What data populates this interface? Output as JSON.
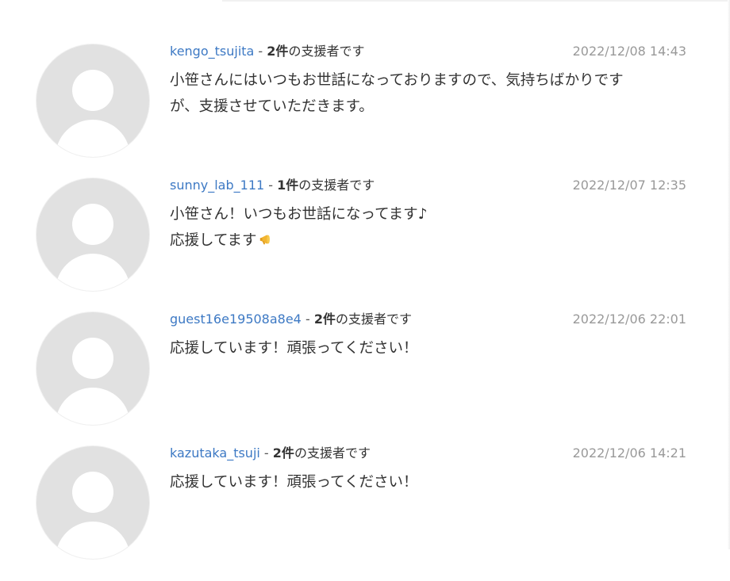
{
  "comments": [
    {
      "username": "kengo_tsujita",
      "separator": " - ",
      "count": "2件",
      "suffix": "の支援者です",
      "date": "2022/12/08 14:43",
      "text": "小笹さんにはいつもお世話になっておりますので、気持ちばかりです\nが、支援させていただきます。"
    },
    {
      "username": "sunny_lab_111",
      "separator": " - ",
      "count": "1件",
      "suffix": "の支援者です",
      "date": "2022/12/07 12:35",
      "text": "小笹さん！いつもお世話になってます♪\n応援してます",
      "emoji": "megaphone-icon"
    },
    {
      "username": "guest16e19508a8e4",
      "separator": " - ",
      "count": "2件",
      "suffix": "の支援者です",
      "date": "2022/12/06 22:01",
      "text": "応援しています！頑張ってください！"
    },
    {
      "username": "kazutaka_tsuji",
      "separator": " - ",
      "count": "2件",
      "suffix": "の支援者です",
      "date": "2022/12/06 14:21",
      "text": "応援しています！頑張ってください！"
    }
  ],
  "colors": {
    "username": "#3d79c4",
    "date": "#999999",
    "text": "#333333",
    "avatar_bg": "#e1e1e1"
  }
}
